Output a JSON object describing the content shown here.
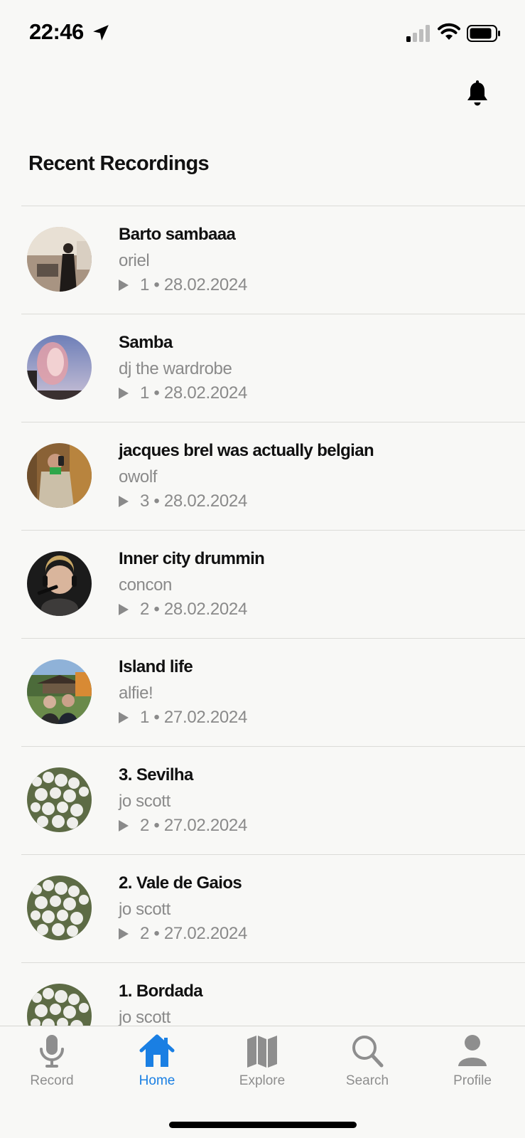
{
  "status_bar": {
    "time": "22:46"
  },
  "section_title": "Recent Recordings",
  "recordings": [
    {
      "title": "Barto sambaaa",
      "author": "oriel",
      "meta": "1 • 28.02.2024",
      "avatar": "kitchen-photo"
    },
    {
      "title": "Samba",
      "author": "dj the wardrobe",
      "meta": "1 • 28.02.2024",
      "avatar": "sky-photo"
    },
    {
      "title": "jacques brel was actually belgian",
      "author": "owolf",
      "meta": "3 • 28.02.2024",
      "avatar": "mirror-selfie-photo"
    },
    {
      "title": "Inner city drummin",
      "author": "concon",
      "meta": "2 • 28.02.2024",
      "avatar": "headset-portrait-photo"
    },
    {
      "title": "Island life",
      "author": "alfie!",
      "meta": "1 • 27.02.2024",
      "avatar": "garden-photo"
    },
    {
      "title": "3. Sevilha",
      "author": "jo scott",
      "meta": "2 • 27.02.2024",
      "avatar": "white-flowers-photo"
    },
    {
      "title": "2. Vale de Gaios",
      "author": "jo scott",
      "meta": "2 • 27.02.2024",
      "avatar": "white-flowers-photo"
    },
    {
      "title": "1. Bordada",
      "author": "jo scott",
      "meta": "",
      "avatar": "white-flowers-photo"
    }
  ],
  "tabbar": {
    "record": "Record",
    "home": "Home",
    "explore": "Explore",
    "search": "Search",
    "profile": "Profile"
  },
  "colors": {
    "accent": "#1a7fe3",
    "muted": "#8a8a8a",
    "background": "#f8f8f6"
  }
}
